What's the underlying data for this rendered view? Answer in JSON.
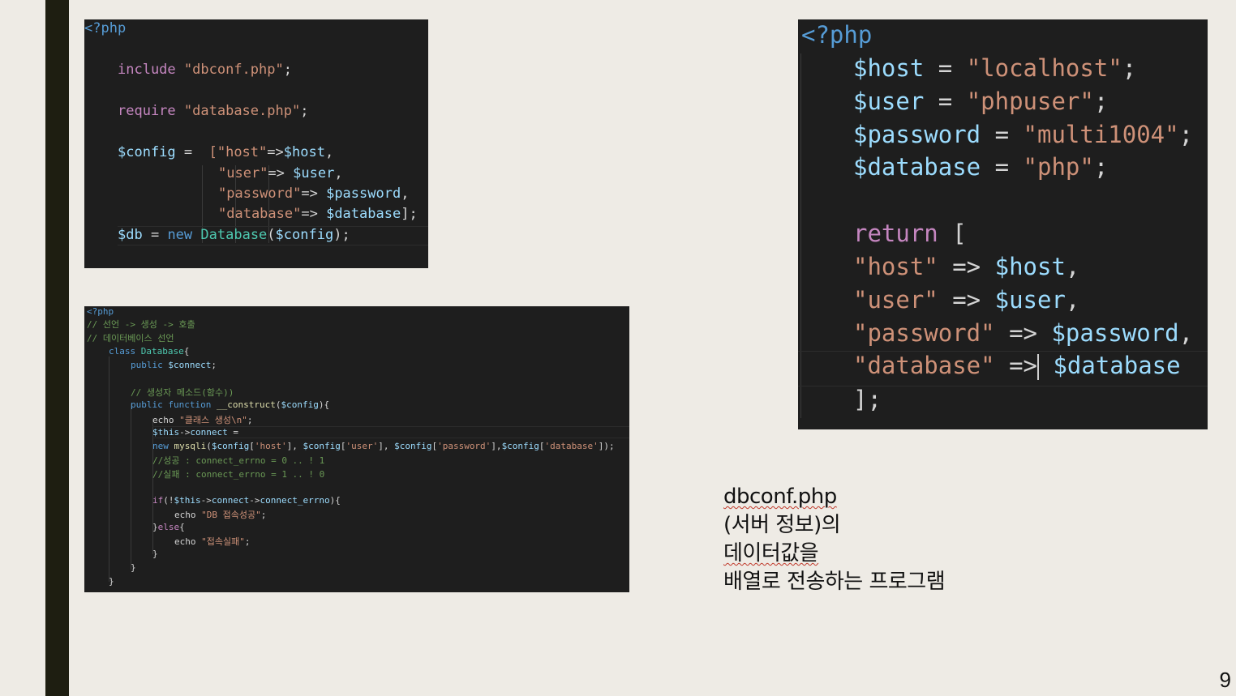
{
  "slide": {
    "page_number": "9"
  },
  "caption": {
    "line1_a": "dbconf.php",
    "line1_b": "(서버 정보)의 ",
    "line1_c": "데이터값을",
    "line2": "배열로 전송하는 프로그램"
  },
  "code1": {
    "php_tag": "<?php",
    "include_kw": "include",
    "include_file": "\"dbconf.php\"",
    "require_kw": "require",
    "require_file": "\"database.php\"",
    "config_var": "$config",
    "host_key": "[\"host\"",
    "host_var": "$host",
    "user_key": "\"user\"",
    "user_var": "$user",
    "password_key": "\"password\"",
    "password_var": "$password",
    "database_key": "\"database\"",
    "database_var": "$database",
    "db_var": "$db",
    "new_kw": "new",
    "class_name": "Database",
    "config_arg": "$config"
  },
  "code2": {
    "php_tag": "<?php",
    "comment1": "// 선언 -> 생성 -> 호출",
    "comment2": "// 데이터베이스 선언",
    "class_kw": "class",
    "class_name": "Database",
    "public_kw": "public",
    "connect_var": "$connect",
    "comment3": "// 생성자 메소드(함수))",
    "function_kw": "function",
    "construct_name": "__construct",
    "config_var": "$config",
    "echo1_str": "\"클래스 생성\\n\"",
    "this_var": "$this",
    "connect_prop": "connect",
    "new_kw": "new",
    "mysqli_fn": "mysqli",
    "host_key": "'host'",
    "user_key": "'user'",
    "password_key": "'password'",
    "database_key": "'database'",
    "comment4": "//성공 : connect_errno = 0 .. ! 1",
    "comment5": "//실패 : connect_errno = 1 .. ! 0",
    "if_kw": "if",
    "errno_prop": "connect_errno",
    "echo_kw": "echo",
    "success_str": "\"DB 접속성공\"",
    "else_kw": "else",
    "fail_str": "\"접속실패\""
  },
  "code3": {
    "php_tag": "<?php",
    "host_var": "$host",
    "host_val": "\"localhost\"",
    "user_var": "$user",
    "user_val": "\"phpuser\"",
    "password_var": "$password",
    "password_val": "\"multi1004\"",
    "database_var": "$database",
    "database_val": "\"php\"",
    "return_kw": "return",
    "host_key": "\"host\"",
    "user_key": "\"user\"",
    "password_key": "\"password\"",
    "database_key": "\"database\""
  }
}
